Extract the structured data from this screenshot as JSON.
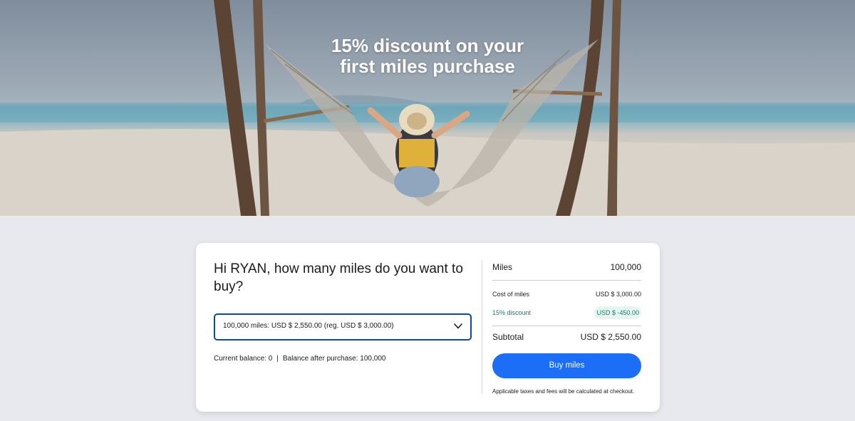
{
  "hero": {
    "title_line1": "15% discount on your",
    "title_line2": "first miles purchase"
  },
  "purchase": {
    "question": "Hi RYAN, how many miles do you want to buy?",
    "selected_option": "100,000 miles: USD $ 2,550.00 (reg. USD $ 3,000.00)",
    "current_balance": "Current balance: 0",
    "separator": "|",
    "balance_after": "Balance after purchase: 100,000"
  },
  "summary": {
    "miles_label": "Miles",
    "miles_value": "100,000",
    "cost_label": "Cost of miles",
    "cost_value": "USD $ 3,000.00",
    "discount_label": "15% discount",
    "discount_value": "USD $ -450.00",
    "subtotal_label": "Subtotal",
    "subtotal_value": "USD $ 2,550.00",
    "buy_button": "Buy miles",
    "note": "Applicable taxes and fees will be calculated at checkout."
  },
  "colors": {
    "primary": "#1b6ef5",
    "select_border": "#0a4aa0",
    "discount_text": "#1a7a68",
    "discount_bg": "#e5f5f0",
    "page_bg": "#e8e9ee"
  },
  "icons": {
    "dropdown": "chevron-down-icon"
  }
}
